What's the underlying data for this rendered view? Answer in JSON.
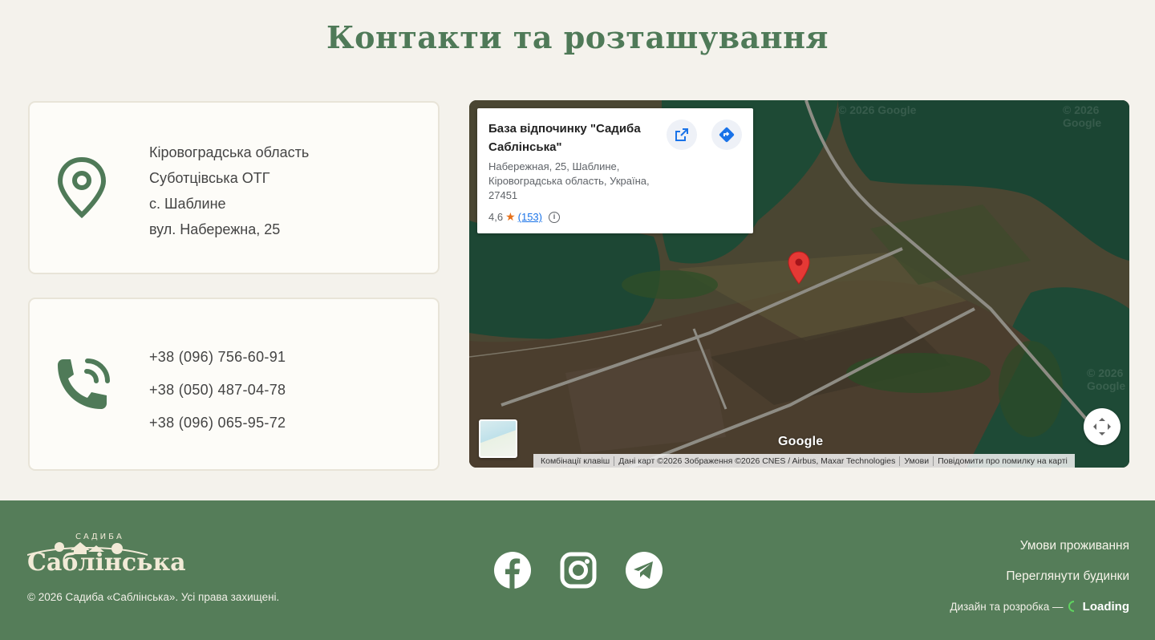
{
  "section": {
    "title": "Контакти та розташування"
  },
  "address_card": {
    "icon": "location-pin-icon",
    "lines": [
      "Кіровоградська область",
      "Суботцівська ОТГ",
      "с. Шаблине",
      "вул. Набережна, 25"
    ]
  },
  "phone_card": {
    "icon": "phone-ringing-icon",
    "phones": [
      "+38 (096) 756-60-91",
      "+38 (050) 487-04-78",
      "+38 (096) 065-95-72"
    ]
  },
  "map": {
    "place_title": "База відпочинку \"Садиба Саблінська\"",
    "place_address": "Набережная, 25, Шаблине, Кіровоградська область, Україна, 27451",
    "rating": "4,6",
    "reviews": "(153)",
    "google_label": "Google",
    "watermark": "© 2026 Google",
    "attribution": [
      "Комбінації клавіш",
      "Дані карт ©2026 Зображення ©2026 CNES / Airbus, Maxar Technologies",
      "Умови",
      "Повідомити про помилку на карті"
    ],
    "colors": {
      "pin": "#e53935",
      "water": "#1e4a35"
    }
  },
  "footer": {
    "logo_small": "САДИБА",
    "logo_main": "Саблінська",
    "copyright": "© 2026 Садиба «Саблінська». Усі права захищені.",
    "socials": [
      "facebook-icon",
      "instagram-icon",
      "telegram-icon"
    ],
    "links": [
      "Умови проживання",
      "Переглянути будинки"
    ],
    "credit_text": "Дизайн та розробка —",
    "credit_brand": "Loading",
    "colors": {
      "background": "#557d59",
      "accent": "#4f7a58"
    }
  }
}
